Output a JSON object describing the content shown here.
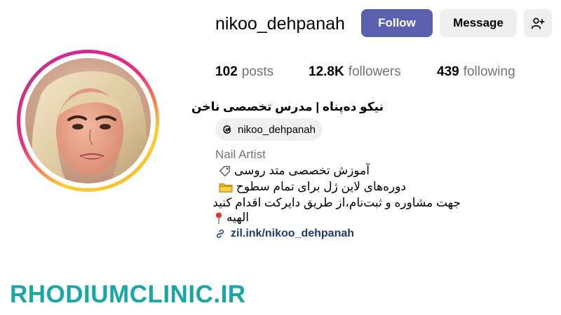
{
  "profile": {
    "username": "nikoo_dehpanah",
    "full_name": "نیکو ده‌پناه | مدرس تخصصی ناخن",
    "threads_handle": "nikoo_dehpanah",
    "category": "Nail Artist",
    "bio": {
      "line1": "آموزش تخصصی متد روسی",
      "line2": "دوره‌های لاین ژل برای تمام سطوح",
      "line3": "جهت مشاوره و ثبت‌نام،از طریق دایرکت اقدام کنید",
      "line4": "الهیه"
    },
    "link": "zil.ink/nikoo_dehpanah"
  },
  "actions": {
    "follow": "Follow",
    "message": "Message"
  },
  "stats": {
    "posts_count": "102",
    "posts_label": "posts",
    "followers_count": "12.8K",
    "followers_label": "followers",
    "following_count": "439",
    "following_label": "following"
  },
  "watermark": "RHODIUMCLINIC.IR",
  "colors": {
    "follow_button": "#5a5fae",
    "secondary_button": "#efefef",
    "muted_text": "#737373",
    "link_text": "#1e3a73",
    "watermark": "#1aa6a6"
  },
  "icons": {
    "add_user": "add-user-icon",
    "threads": "threads-icon",
    "link": "link-icon",
    "bio1_emoji": "label-tag-emoji",
    "bio2_emoji": "folder-emoji",
    "bio4_emoji": "round-pushpin-emoji"
  }
}
